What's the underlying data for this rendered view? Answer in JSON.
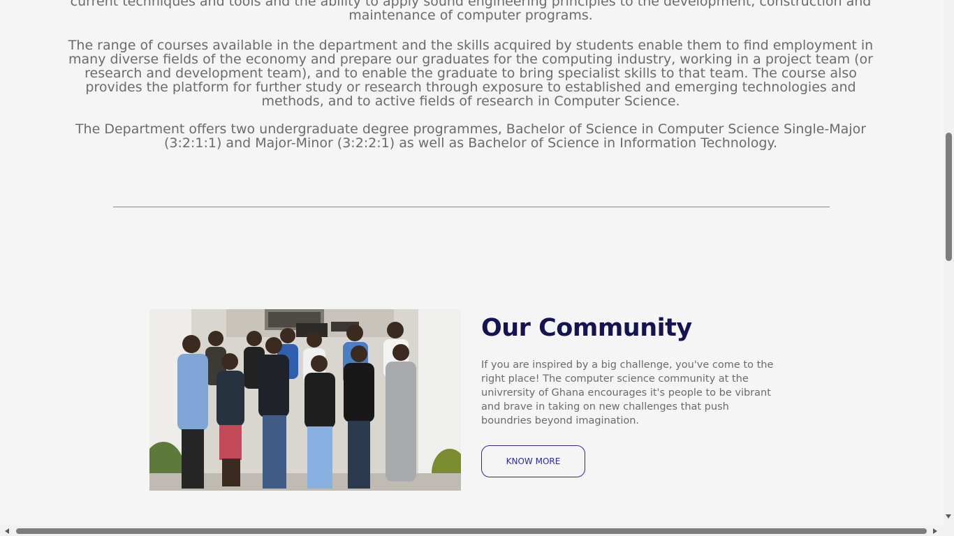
{
  "intro": {
    "paragraph0": "current techniques and tools and the ability to apply sound engineering principles to the development, construction and maintenance of computer programs.",
    "paragraph1": "The range of courses available in the department and the skills acquired by students enable them to find employment in many diverse fields of the economy and prepare our graduates for the computing industry, working in a project team (or research and development team), and to enable the graduate to bring specialist skills to that team. The course also provides the platform for further study or research through exposure to established and emerging technologies and methods, and to active fields of research in Computer Science.",
    "paragraph2": "The Department offers two undergraduate degree programmes, Bachelor of Science in Computer Science Single-Major (3:2:1:1) and Major-Minor (3:2:2:1) as well as Bachelor of Science in Information Technology."
  },
  "community": {
    "title": "Our Community",
    "body": "If you are inspired by a big challenge, you've come to the right place! The computer science community at the univrersity of Ghana encourages it's people to be vibrant and brave in taking on new challenges that push boundries beyond imagination.",
    "button_label": "KNOW MORE",
    "photo_icon": "group-photo"
  },
  "colors": {
    "background": "#f5f5f5",
    "title": "#141452",
    "body_text": "#6b6b6b",
    "button_border": "#2a2a9a"
  }
}
